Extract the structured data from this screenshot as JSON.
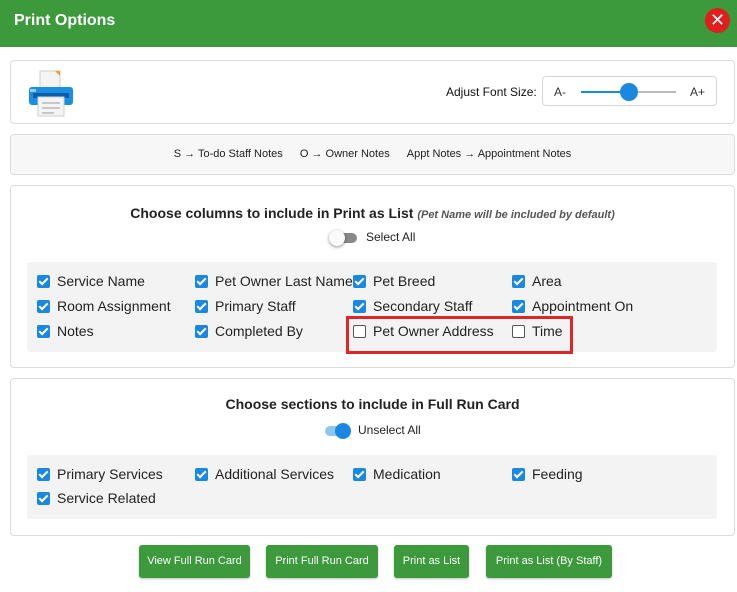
{
  "header": {
    "title": "Print Options"
  },
  "font_size": {
    "label": "Adjust Font Size:",
    "decrease": "A-",
    "increase": "A+",
    "level": 0.5
  },
  "legend": [
    "S → To-do Staff Notes",
    "O → Owner Notes",
    "Appt Notes → Appointment Notes"
  ],
  "columns": {
    "title": "Choose columns to include in Print as List",
    "note": "(Pet Name will be included by default)",
    "toggle_label": "Select All",
    "toggle_on": false,
    "items": [
      {
        "label": "Service Name",
        "checked": true
      },
      {
        "label": "Pet Owner Last Name",
        "checked": true
      },
      {
        "label": "Pet Breed",
        "checked": true
      },
      {
        "label": "Area",
        "checked": true
      },
      {
        "label": "Room Assignment",
        "checked": true
      },
      {
        "label": "Primary Staff",
        "checked": true
      },
      {
        "label": "Secondary Staff",
        "checked": true
      },
      {
        "label": "Appointment On",
        "checked": true
      },
      {
        "label": "Notes",
        "checked": true
      },
      {
        "label": "Completed By",
        "checked": true
      },
      {
        "label": "Pet Owner Address",
        "checked": false
      },
      {
        "label": "Time",
        "checked": false
      }
    ]
  },
  "sections": {
    "title": "Choose sections to include in Full Run Card",
    "toggle_label": "Unselect All",
    "toggle_on": true,
    "items": [
      {
        "label": "Primary Services",
        "checked": true
      },
      {
        "label": "Additional Services",
        "checked": true
      },
      {
        "label": "Medication",
        "checked": true
      },
      {
        "label": "Feeding",
        "checked": true
      },
      {
        "label": "Service Related",
        "checked": true
      }
    ]
  },
  "buttons": [
    "View Full Run Card",
    "Print Full Run Card",
    "Print as List",
    "Print as List (By Staff)"
  ],
  "colors": {
    "header": "#3c9a3c",
    "accent": "#1a88e0",
    "close": "#e01e1e",
    "highlight": "#e02626"
  }
}
